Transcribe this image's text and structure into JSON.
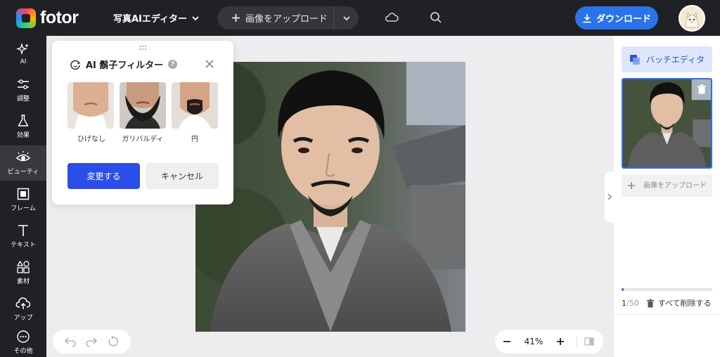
{
  "app": {
    "logo_text": "fotor",
    "avatar_icon": "cat-avatar-icon"
  },
  "topbar": {
    "editor_menu_label": "写真AIエディター",
    "upload_label": "画像をアップロード",
    "download_label": "ダウンロード"
  },
  "sidebar": {
    "items": [
      {
        "label": "AI",
        "icon": "sparkle-icon"
      },
      {
        "label": "調整",
        "icon": "sliders-icon"
      },
      {
        "label": "効果",
        "icon": "flask-icon"
      },
      {
        "label": "ビューティ",
        "icon": "eye-icon"
      },
      {
        "label": "フレーム",
        "icon": "frame-icon"
      },
      {
        "label": "テキスト",
        "icon": "text-icon"
      },
      {
        "label": "素材",
        "icon": "shapes-icon"
      },
      {
        "label": "アップ",
        "icon": "cloud-upload-icon"
      },
      {
        "label": "その他",
        "icon": "more-icon"
      }
    ],
    "active_index": 3
  },
  "filter_panel": {
    "title": "AI 鬍子フィルター",
    "help": "?",
    "options": [
      {
        "label": "ひげなし"
      },
      {
        "label": "ガリバルディ"
      },
      {
        "label": "円"
      }
    ],
    "apply_label": "変更する",
    "cancel_label": "キャンセル"
  },
  "zoom": {
    "value": "41%"
  },
  "right_panel": {
    "batch_label": "バッチエディタ",
    "upload_label": "画像をアップロード",
    "count_current": "1",
    "count_total": "/50",
    "progress": 0.02,
    "delete_all_label": "すべて削除する"
  },
  "colors": {
    "accent": "#2a73ea",
    "apply": "#2b4de8",
    "topbar": "#202124"
  }
}
